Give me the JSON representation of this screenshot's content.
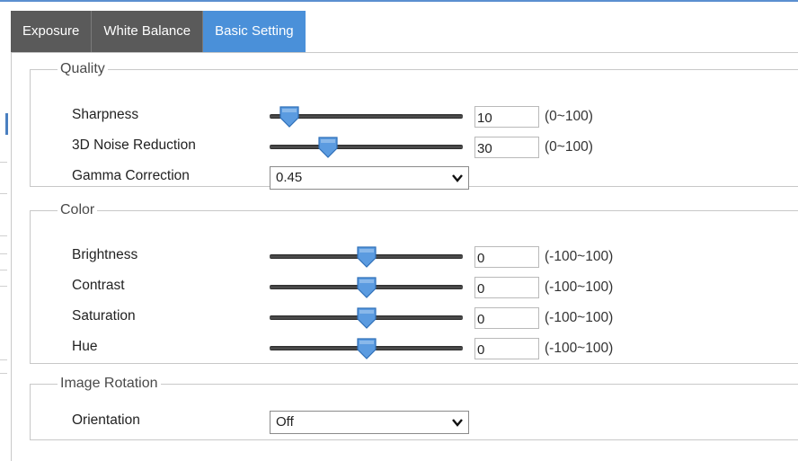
{
  "tabs": [
    {
      "label": "Exposure",
      "active": false
    },
    {
      "label": "White Balance",
      "active": false
    },
    {
      "label": "Basic Setting",
      "active": true
    }
  ],
  "quality": {
    "title": "Quality",
    "sharpness": {
      "label": "Sharpness",
      "value": "10",
      "range": "(0~100)",
      "fraction": 0.1
    },
    "noise_reduction": {
      "label": "3D Noise Reduction",
      "value": "30",
      "range": "(0~100)",
      "fraction": 0.3
    },
    "gamma": {
      "label": "Gamma Correction",
      "selected": "0.45"
    }
  },
  "color": {
    "title": "Color",
    "brightness": {
      "label": "Brightness",
      "value": "0",
      "range": "(-100~100)",
      "fraction": 0.5
    },
    "contrast": {
      "label": "Contrast",
      "value": "0",
      "range": "(-100~100)",
      "fraction": 0.5
    },
    "saturation": {
      "label": "Saturation",
      "value": "0",
      "range": "(-100~100)",
      "fraction": 0.5
    },
    "hue": {
      "label": "Hue",
      "value": "0",
      "range": "(-100~100)",
      "fraction": 0.5
    }
  },
  "rotation": {
    "title": "Image Rotation",
    "orientation": {
      "label": "Orientation",
      "selected": "Off"
    }
  },
  "colors": {
    "tab_active": "#4a90d9",
    "tab_inactive": "#5a5a5a",
    "thumb": "#5b9be0"
  },
  "icons": {
    "slider_thumb": "slider-thumb-icon",
    "dropdown": "chevron-down-icon"
  }
}
